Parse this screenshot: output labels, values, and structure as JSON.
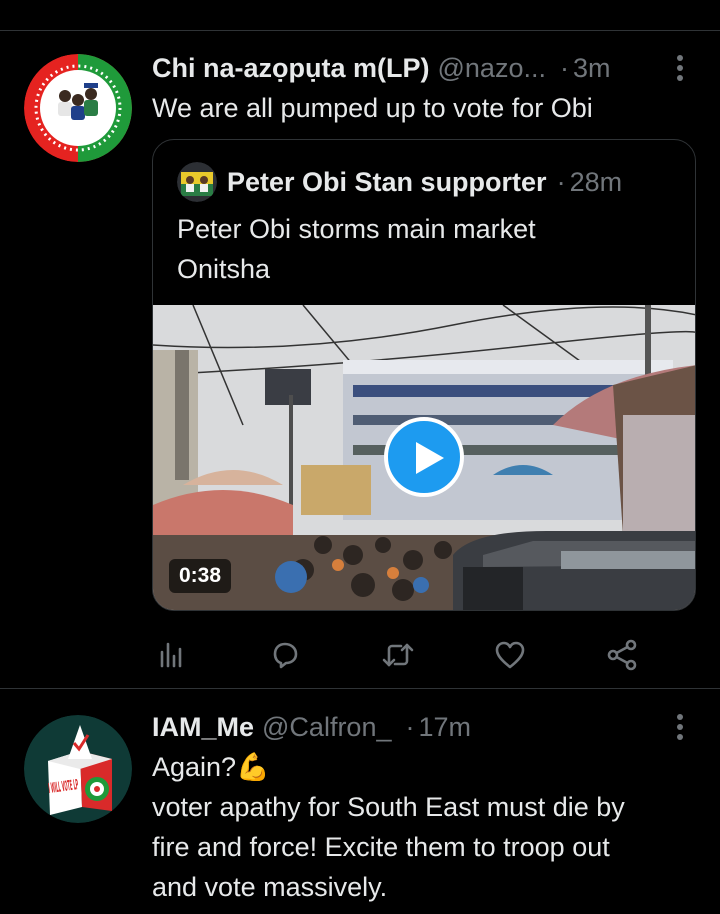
{
  "colors": {
    "background": "#000000",
    "text": "#e7e9ea",
    "muted": "#71767b",
    "accent": "#1d9bf0",
    "divider": "#2f3336"
  },
  "tweets": [
    {
      "display_name": "Chi na-azọpụta m(LP)",
      "handle": "@nazo...",
      "separator": "·",
      "time": "3m",
      "text": "We are all pumped up to vote for Obi",
      "avatar_text": "FORWARD EVER",
      "quoted": {
        "display_name": "Peter Obi Stan supporter",
        "separator": "·",
        "time": "28m",
        "text_lines": [
          "Peter Obi storms main market",
          "Onitsha"
        ],
        "media": {
          "type": "video",
          "duration": "0:38"
        }
      },
      "actions": [
        "analytics-icon",
        "reply-icon",
        "retweet-icon",
        "like-icon",
        "share-icon"
      ]
    },
    {
      "display_name": "IAM_Me",
      "handle": "@Calfron_",
      "separator": "·",
      "time": "17m",
      "avatar_text": "I WILL VOTE LP",
      "text_lines": [
        "Again?💪",
        "voter apathy for South East must die by",
        "fire and force! Excite them to troop out",
        "and vote massively."
      ]
    }
  ]
}
